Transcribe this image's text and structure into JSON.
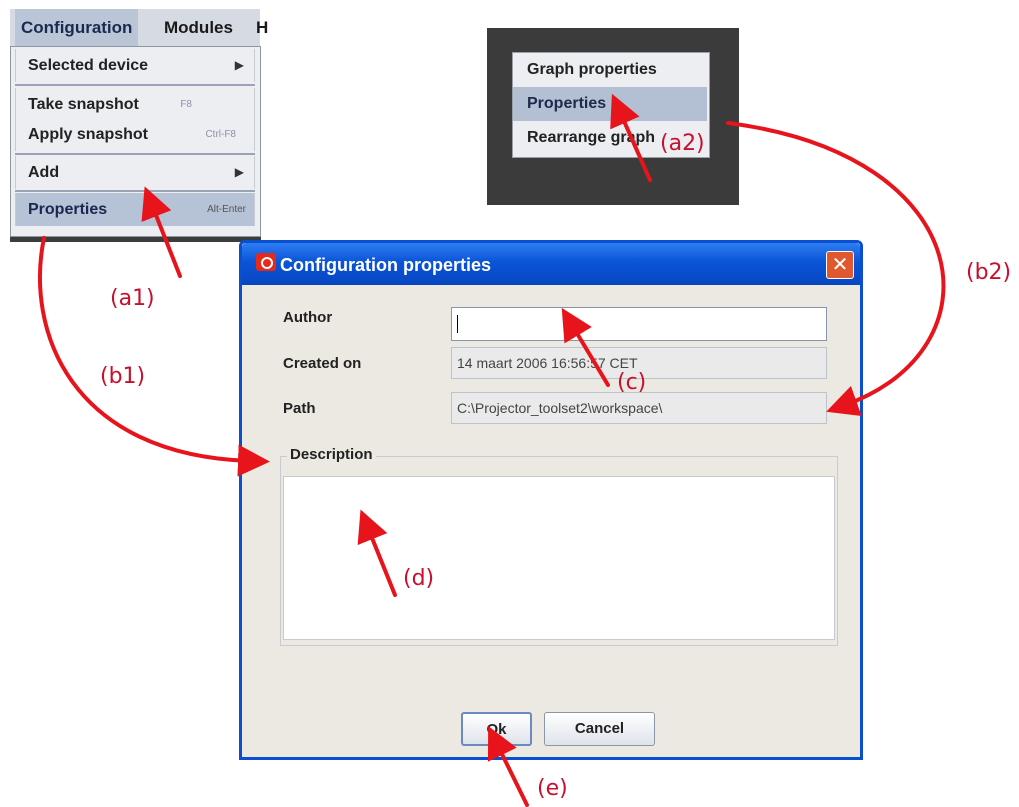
{
  "menu": {
    "menubar": [
      "Configuration",
      "Modules",
      "H"
    ],
    "items": {
      "selected_device": "Selected device",
      "take_snapshot": "Take snapshot",
      "take_snapshot_key": "F8",
      "apply_snapshot": "Apply snapshot",
      "apply_snapshot_key": "Ctrl-F8",
      "add": "Add",
      "properties": "Properties",
      "properties_key": "Alt-Enter"
    }
  },
  "context_menu": {
    "items": [
      "Graph properties",
      "Properties",
      "Rearrange graph"
    ]
  },
  "dialog": {
    "title": "Configuration properties",
    "close_glyph": "✕",
    "author_label": "Author",
    "author_value": "",
    "created_label": "Created on",
    "created_value": "14 maart 2006 16:56:57 CET",
    "path_label": "Path",
    "path_value": "C:\\Projector_toolset2\\workspace\\",
    "description_label": "Description",
    "ok_label": "Ok",
    "cancel_label": "Cancel"
  },
  "annotations": {
    "a1": "(a1)",
    "a2": "(a2)",
    "b1": "(b1)",
    "b2": "(b2)",
    "c": "(c)",
    "d": "(d)",
    "e": "(e)"
  },
  "colors": {
    "annotation": "#e8141c",
    "titlebar": "#0a54d8"
  }
}
